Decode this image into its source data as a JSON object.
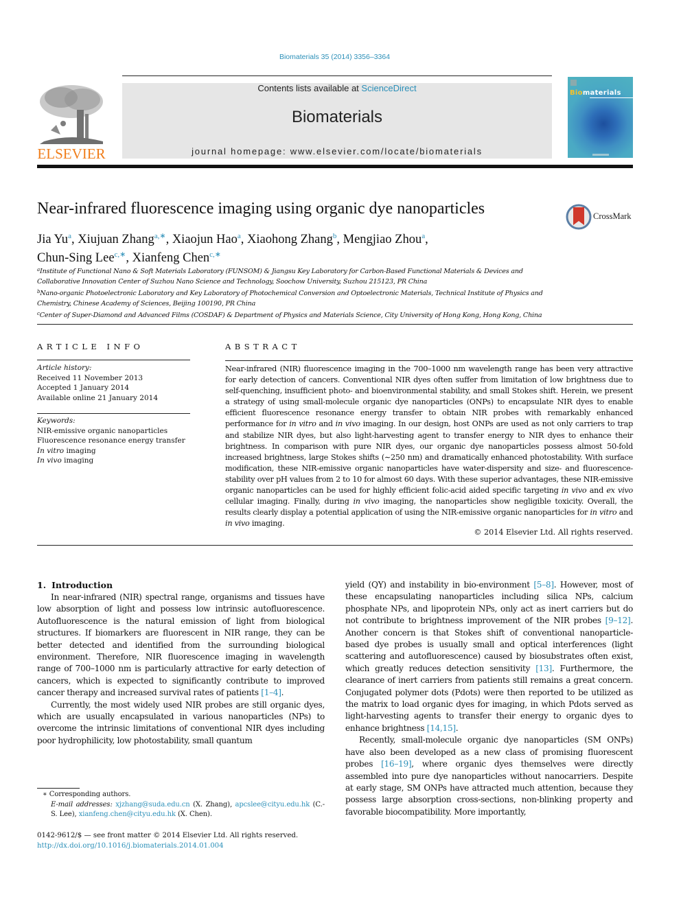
{
  "header": {
    "journal_ref": "Biomaterials 35 (2014) 3356–3364",
    "contents_prefix": "Contents lists available at ",
    "contents_link": "ScienceDirect",
    "journal_name": "Biomaterials",
    "homepage": "journal homepage: www.elsevier.com/locate/biomaterials",
    "publisher_logo": "ELSEVIER",
    "cover_title_highlight": "Bio",
    "cover_title_rest": "materials",
    "crossmark_label": "CrossMark",
    "colors": {
      "link": "#2b8fb8",
      "elsevier_orange": "#f07d1a",
      "header_gray": "#e6e6e6"
    }
  },
  "article": {
    "title": "Near-infrared fluorescence imaging using organic dye nanoparticles",
    "authors": [
      {
        "name": "Jia Yu",
        "sup": "a"
      },
      {
        "name": "Xiujuan Zhang",
        "sup": "a,∗"
      },
      {
        "name": "Xiaojun Hao",
        "sup": "a"
      },
      {
        "name": "Xiaohong Zhang",
        "sup": "b"
      },
      {
        "name": "Mengjiao Zhou",
        "sup": "a"
      },
      {
        "name": "Chun-Sing Lee",
        "sup": "c,∗"
      },
      {
        "name": "Xianfeng Chen",
        "sup": "c,∗"
      }
    ],
    "affiliations": [
      {
        "sup": "a",
        "text": "Institute of Functional Nano & Soft Materials Laboratory (FUNSOM) & Jiangsu Key Laboratory for Carbon-Based Functional Materials & Devices and Collaborative Innovation Center of Suzhou Nano Science and Technology, Soochow University, Suzhou 215123, PR China"
      },
      {
        "sup": "b",
        "text": "Nano-organic Photoelectronic Laboratory and Key Laboratory of Photochemical Conversion and Optoelectronic Materials, Technical Institute of Physics and Chemistry, Chinese Academy of Sciences, Beijing 100190, PR China"
      },
      {
        "sup": "c",
        "text": "Center of Super-Diamond and Advanced Films (COSDAF) & Department of Physics and Materials Science, City University of Hong Kong, Hong Kong, China"
      }
    ]
  },
  "article_info": {
    "heading": "ARTICLE INFO",
    "history_label": "Article history:",
    "history": [
      "Received 11 November 2013",
      "Accepted 1 January 2014",
      "Available online 21 January 2014"
    ],
    "keywords_label": "Keywords:",
    "keywords": [
      {
        "italic": "",
        "text": "NIR-emissive organic nanoparticles"
      },
      {
        "italic": "",
        "text": "Fluorescence resonance energy transfer"
      },
      {
        "italic": "In vitro",
        "text": " imaging"
      },
      {
        "italic": "In vivo",
        "text": " imaging"
      }
    ]
  },
  "abstract": {
    "heading": "ABSTRACT",
    "segments": [
      {
        "t": "Near-infrared (NIR) fluorescence imaging in the 700–1000 nm wavelength range has been very attractive for early detection of cancers. Conventional NIR dyes often suffer from limitation of low brightness due to self-quenching, insufficient photo- and bioenvironmental stability, and small Stokes shift. Herein, we present a strategy of using small-molecule organic dye nanoparticles (ONPs) to encapsulate NIR dyes to enable efficient fluorescence resonance energy transfer to obtain NIR probes with remarkably enhanced performance for "
      },
      {
        "i": "in vitro"
      },
      {
        "t": " and "
      },
      {
        "i": "in vivo"
      },
      {
        "t": " imaging. In our design, host ONPs are used as not only carriers to trap and stabilize NIR dyes, but also light-harvesting agent to transfer energy to NIR dyes to enhance their brightness. In comparison with pure NIR dyes, our organic dye nanoparticles possess almost 50-fold increased brightness, large Stokes shifts (∼250 nm) and dramatically enhanced photostability. With surface modification, these NIR-emissive organic nanoparticles have water-dispersity and size- and fluorescence- stability over pH values from 2 to 10 for almost 60 days. With these superior advantages, these NIR-emissive organic nanoparticles can be used for highly efficient folic-acid aided specific targeting "
      },
      {
        "i": "in vivo"
      },
      {
        "t": " and "
      },
      {
        "i": "ex vivo"
      },
      {
        "t": " cellular imaging. Finally, during "
      },
      {
        "i": "in vivo"
      },
      {
        "t": " imaging, the nanoparticles show negligible toxicity. Overall, the results clearly display a potential application of using the NIR-emissive organic nanoparticles for "
      },
      {
        "i": "in vitro"
      },
      {
        "t": " and "
      },
      {
        "i": "in vivo"
      },
      {
        "t": " imaging."
      }
    ],
    "copyright": "© 2014 Elsevier Ltd. All rights reserved."
  },
  "introduction": {
    "number": "1.",
    "heading": "Introduction",
    "left_paragraphs": [
      [
        {
          "t": "In near-infrared (NIR) spectral range, organisms and tissues have low absorption of light and possess low intrinsic autofluorescence. Autofluorescence is the natural emission of light from biological structures. If biomarkers are fluorescent in NIR range, they can be better detected and identified from the surrounding biological environment. Therefore, NIR fluorescence imaging in wavelength range of 700–1000 nm is particularly attractive for early detection of cancers, which is expected to significantly contribute to improved cancer therapy and increased survival rates of patients "
        },
        {
          "ref": "[1–4]"
        },
        {
          "t": "."
        }
      ],
      [
        {
          "t": "Currently, the most widely used NIR probes are still organic dyes, which are usually encapsulated in various nanoparticles (NPs) to overcome the intrinsic limitations of conventional NIR dyes including poor hydrophilicity, low photostability, small quantum"
        }
      ]
    ],
    "right_paragraphs": [
      [
        {
          "t": "yield (QY) and instability in bio-environment "
        },
        {
          "ref": "[5–8]"
        },
        {
          "t": ". However, most of these encapsulating nanoparticles including silica NPs, calcium phosphate NPs, and lipoprotein NPs, only act as inert carriers but do not contribute to brightness improvement of the NIR probes "
        },
        {
          "ref": "[9–12]"
        },
        {
          "t": ". Another concern is that Stokes shift of conventional nanoparticle-based dye probes is usually small and optical interferences (light scattering and autofluorescence) caused by biosubstrates often exist, which greatly reduces detection sensitivity "
        },
        {
          "ref": "[13]"
        },
        {
          "t": ". Furthermore, the clearance of inert carriers from patients still remains a great concern. Conjugated polymer dots (Pdots) were then reported to be utilized as the matrix to load organic dyes for imaging, in which Pdots served as light-harvesting agents to transfer their energy to organic dyes to enhance brightness "
        },
        {
          "ref": "[14,15]"
        },
        {
          "t": "."
        }
      ],
      [
        {
          "t": "Recently, small-molecule organic dye nanoparticles (SM ONPs) have also been developed as a new class of promising fluorescent probes "
        },
        {
          "ref": "[16–19]"
        },
        {
          "t": ", where organic dyes themselves were directly assembled into pure dye nanoparticles without nanocarriers. Despite at early stage, SM ONPs have attracted much attention, because they possess large absorption cross-sections, non-blinking property and favorable biocompatibility. More importantly,"
        }
      ]
    ]
  },
  "footnotes": {
    "corresponding": "∗ Corresponding authors.",
    "email_label": "E-mail addresses:",
    "emails": [
      {
        "addr": "xjzhang@suda.edu.cn",
        "who": " (X. Zhang), "
      },
      {
        "addr": "apcslee@cityu.edu.hk",
        "who": " (C.-S. Lee), "
      },
      {
        "addr": "xianfeng.chen@cityu.edu.hk",
        "who": " (X. Chen)."
      }
    ],
    "issn_line": "0142-9612/$ — see front matter © 2014 Elsevier Ltd. All rights reserved.",
    "doi": "http://dx.doi.org/10.1016/j.biomaterials.2014.01.004"
  }
}
